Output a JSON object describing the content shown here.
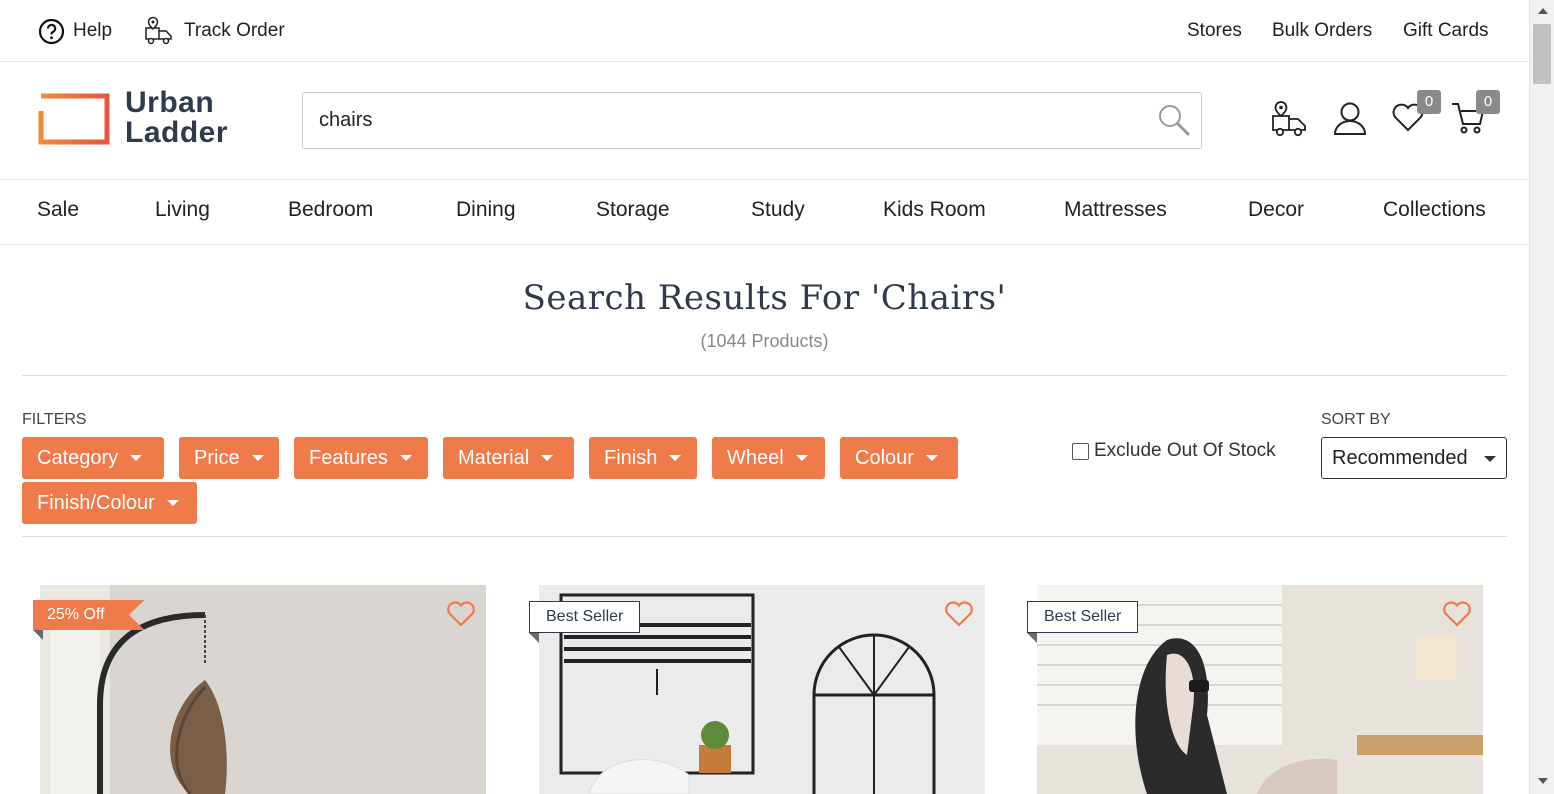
{
  "topbar": {
    "help": "Help",
    "track_order": "Track Order",
    "stores": "Stores",
    "bulk_orders": "Bulk Orders",
    "gift_cards": "Gift Cards"
  },
  "brand": {
    "line1": "Urban",
    "line2": "Ladder",
    "accent": "#ef7a4a",
    "text_color": "#2f3b4c"
  },
  "search": {
    "value": "chairs",
    "placeholder": ""
  },
  "header_icons": {
    "wishlist_count": "0",
    "cart_count": "0"
  },
  "nav": [
    "Sale",
    "Living",
    "Bedroom",
    "Dining",
    "Storage",
    "Study",
    "Kids Room",
    "Mattresses",
    "Decor",
    "Collections"
  ],
  "results": {
    "title": "Search Results For 'Chairs'",
    "count": "(1044 Products)"
  },
  "filters": {
    "label": "FILTERS",
    "buttons": [
      "Category",
      "Price",
      "Features",
      "Material",
      "Finish",
      "Wheel",
      "Colour",
      "Finish/Colour"
    ],
    "exclude_label": "Exclude Out Of Stock",
    "exclude_checked": false
  },
  "sort": {
    "label": "SORT BY",
    "selected": "Recommended"
  },
  "products": [
    {
      "badge": "25% Off",
      "badge_type": "discount"
    },
    {
      "badge": "Best Seller",
      "badge_type": "seller"
    },
    {
      "badge": "Best Seller",
      "badge_type": "seller"
    }
  ]
}
